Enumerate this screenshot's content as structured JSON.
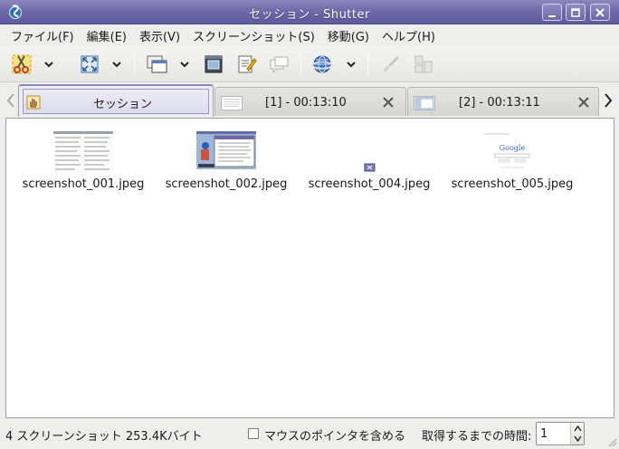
{
  "window": {
    "title": "セッション - Shutter"
  },
  "menubar": {
    "items": [
      "ファイル(F)",
      "編集(E)",
      "表示(V)",
      "スクリーンショット(S)",
      "移動(G)",
      "ヘルプ(H)"
    ]
  },
  "tabs": [
    {
      "label": "セッション",
      "active": true
    },
    {
      "label": "[1] - 00:13:10",
      "active": false
    },
    {
      "label": "[2] - 00:13:11",
      "active": false
    }
  ],
  "files": [
    {
      "name": "screenshot_001.jpeg"
    },
    {
      "name": "screenshot_002.jpeg"
    },
    {
      "name": "screenshot_004.jpeg"
    },
    {
      "name": "screenshot_005.jpeg"
    }
  ],
  "status": {
    "summary": "4 スクリーンショット   253.4Kバイト",
    "include_pointer_label": "マウスのポインタを含める",
    "include_pointer_checked": false,
    "delay_label": "取得するまでの時間:",
    "delay_value": "1"
  },
  "colors": {
    "titlebar": "#6f6aa9",
    "active_tab_border": "#9a98c8",
    "content_bg": "#ffffff"
  }
}
